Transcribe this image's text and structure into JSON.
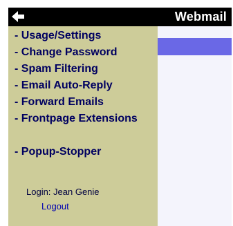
{
  "header": {
    "title": "Webmail",
    "back_icon": "left-arrow-icon"
  },
  "sidebar": {
    "items": [
      {
        "label": "- Usage/Settings"
      },
      {
        "label": "- Change Password"
      },
      {
        "label": "- Spam Filtering"
      },
      {
        "label": "- Email Auto-Reply"
      },
      {
        "label": "- Forward Emails"
      },
      {
        "label": "- Frontpage Extensions"
      },
      {
        "label": "- Popup-Stopper"
      }
    ],
    "login_text": "Login: Jean Genie",
    "logout_label": "Logout"
  },
  "colors": {
    "sidebar_bg": "#cdcc99",
    "titlebar_bg": "#000000",
    "accent_bar": "#6a68e6",
    "content_bg": "#f4f4fc",
    "menu_text": "#000060",
    "link": "#0000b0"
  }
}
